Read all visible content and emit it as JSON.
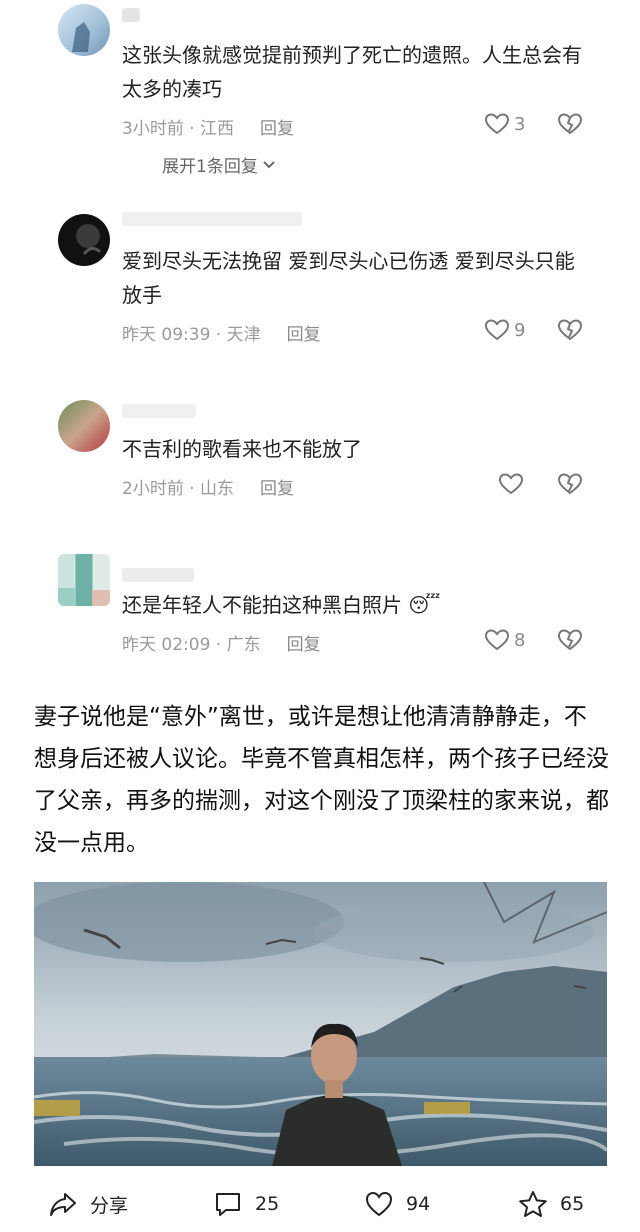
{
  "comments": [
    {
      "text": "这张头像就感觉提前预判了死亡的遗照。人生总会有太多的凑巧",
      "time": "3小时前 · 江西",
      "reply": "回复",
      "likes": "3",
      "expand": "展开1条回复"
    },
    {
      "text": "爱到尽头无法挽留  爱到尽头心已伤透  爱到尽头只能放手",
      "time": "昨天 09:39 · 天津",
      "reply": "回复",
      "likes": "9"
    },
    {
      "text": "不吉利的歌看来也不能放了",
      "time": "2小时前 · 山东",
      "reply": "回复",
      "likes": ""
    },
    {
      "text": "还是年轻人不能拍这种黑白照片",
      "emoji": "😴",
      "time": "昨天 02:09 · 广东",
      "reply": "回复",
      "likes": "8"
    }
  ],
  "article": {
    "paragraph": "妻子说他是“意外”离世，或许是想让他清清静静走，不想身后还被人议论。毕竟不管真相怎样，两个孩子已经没了父亲，再多的揣测，对这个刚没了顶梁柱的家来说，都没一点用。"
  },
  "bottom_bar": {
    "share_label": "分享",
    "comment_count": "25",
    "like_count": "94",
    "favorite_count": "65"
  },
  "icons": [
    "heart-icon",
    "broken-heart-icon",
    "chevron-down-icon",
    "share-icon",
    "comment-icon",
    "star-icon"
  ]
}
